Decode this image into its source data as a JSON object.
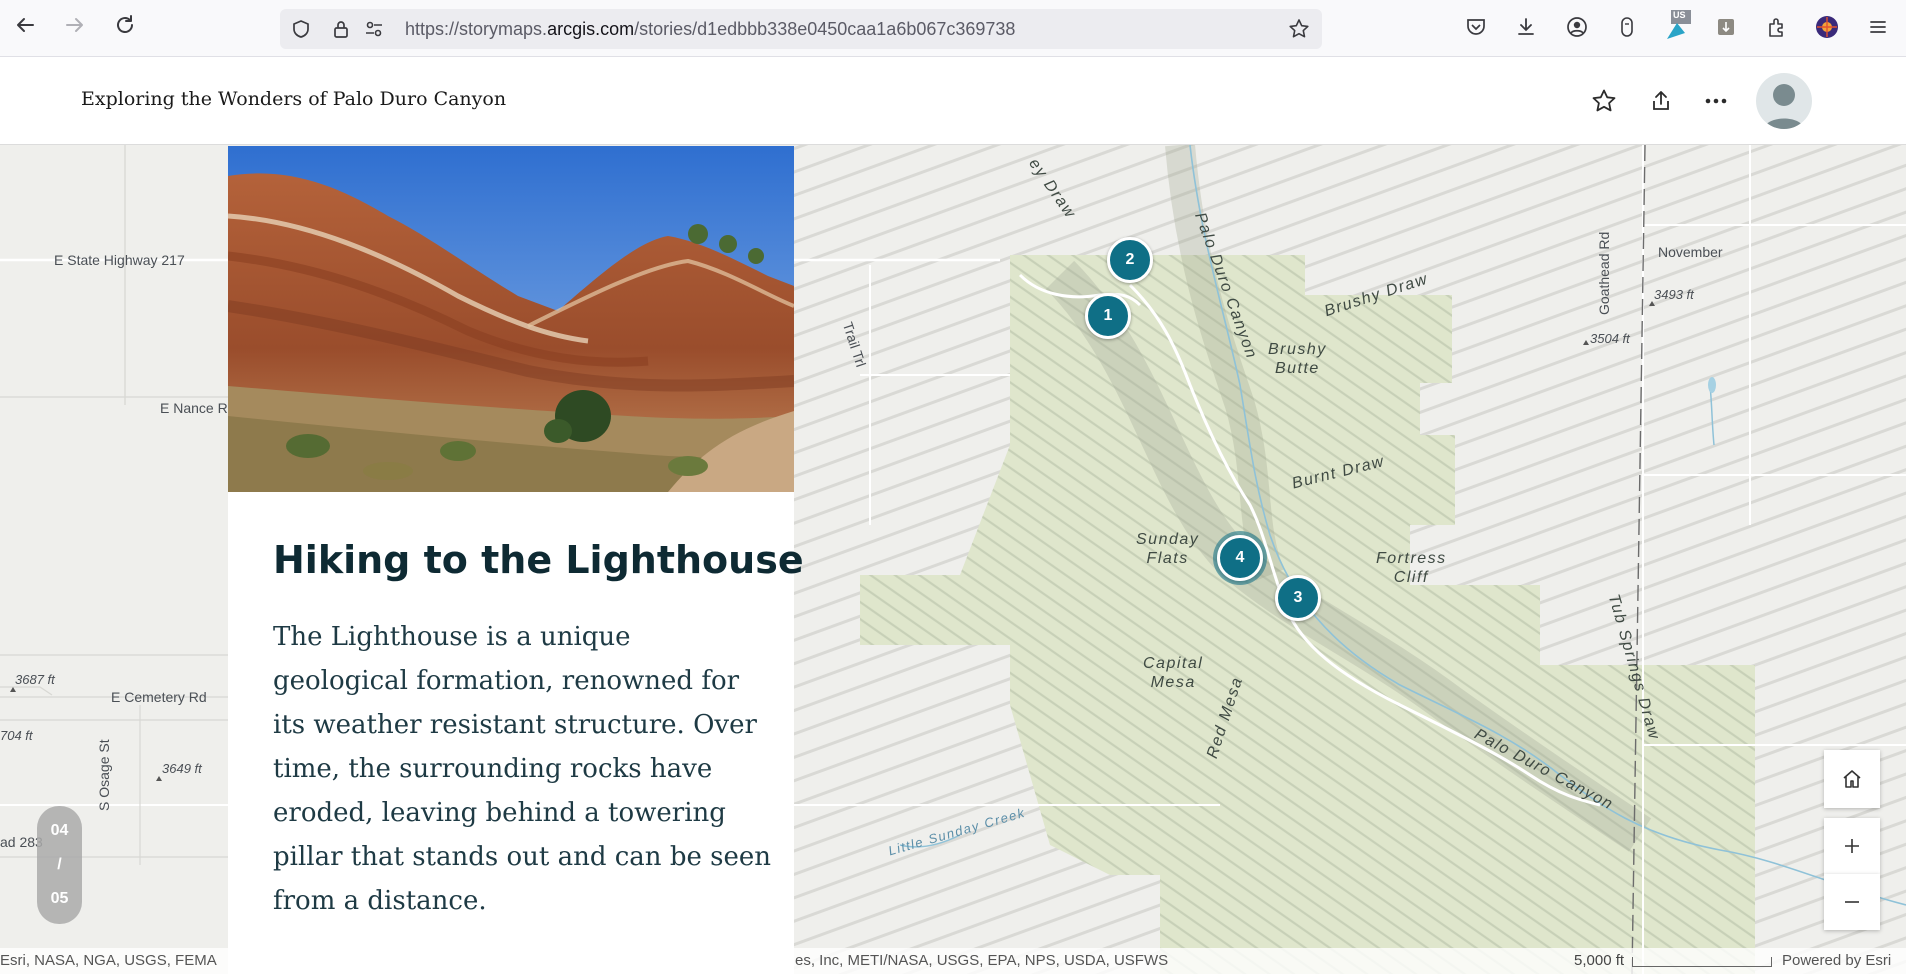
{
  "browser": {
    "url_prefix": "https://storymaps.",
    "url_domain": "arcgis.com",
    "url_path": "/stories/d1edbbb338e0450caa1a6b067c369738",
    "ext_badge": "US"
  },
  "story": {
    "title": "Exploring the Wonders of Palo Duro Canyon"
  },
  "card": {
    "heading": "Hiking to the Lighthouse",
    "body": "The Lighthouse is a unique geological formation, renowned for its weather resistant structure. Over time, the surrounding rocks have eroded, leaving behind a towering pillar that stands out and can be seen from a distance."
  },
  "counter": {
    "current": "04",
    "separator": "/",
    "total": "05"
  },
  "map": {
    "markers": [
      "1",
      "2",
      "3",
      "4"
    ],
    "road_labels": {
      "state_hwy": "E State Highway 217",
      "nance": "E Nance R",
      "cemetery": "E Cemetery Rd",
      "osage": "S Osage St",
      "trail": "Trail Trl",
      "goathead": "Goathead Rd",
      "november": "November",
      "rd283": "ad 283"
    },
    "elevations": {
      "e3687": "3687 ft",
      "e704": "704 ft",
      "e3649": "3649 ft",
      "e3504": "3504 ft",
      "e3493": "3493 ft"
    },
    "terrain": {
      "palo_duro_canyon": "Palo Duro Canyon",
      "brushy_draw": "Brushy Draw",
      "brushy_butte_1": "Brushy",
      "brushy_butte_2": "Butte",
      "burnt_draw": "Burnt Draw",
      "sunday_flats_1": "Sunday",
      "sunday_flats_2": "Flats",
      "fortress_cliff_1": "Fortress",
      "fortress_cliff_2": "Cliff",
      "capital_mesa_1": "Capital",
      "capital_mesa_2": "Mesa",
      "red_mesa": "Red Mesa",
      "tub_springs": "Tub Springs Draw",
      "palo_duro_canyon_2": "Palo Duro Canyon",
      "little_sunday": "Little Sunday Creek",
      "draw_top": "ey Draw"
    },
    "attribution_left": "Esri, NASA, NGA, USGS, FEMA",
    "attribution_right": "es, Inc, METI/NASA, USGS, EPA, NPS, USDA, USFWS",
    "scale": "5,000 ft",
    "powered_by": "Powered by Esri"
  },
  "icons": [
    "back-icon",
    "forward-icon",
    "reload-icon",
    "shield-icon",
    "lock-icon",
    "permissions-icon",
    "bookmark-star-icon",
    "pocket-icon",
    "download-icon",
    "account-icon",
    "extension-icons",
    "menu-icon",
    "favorite-icon",
    "share-icon",
    "more-icon",
    "home-icon",
    "zoom-in-icon",
    "zoom-out-icon"
  ]
}
